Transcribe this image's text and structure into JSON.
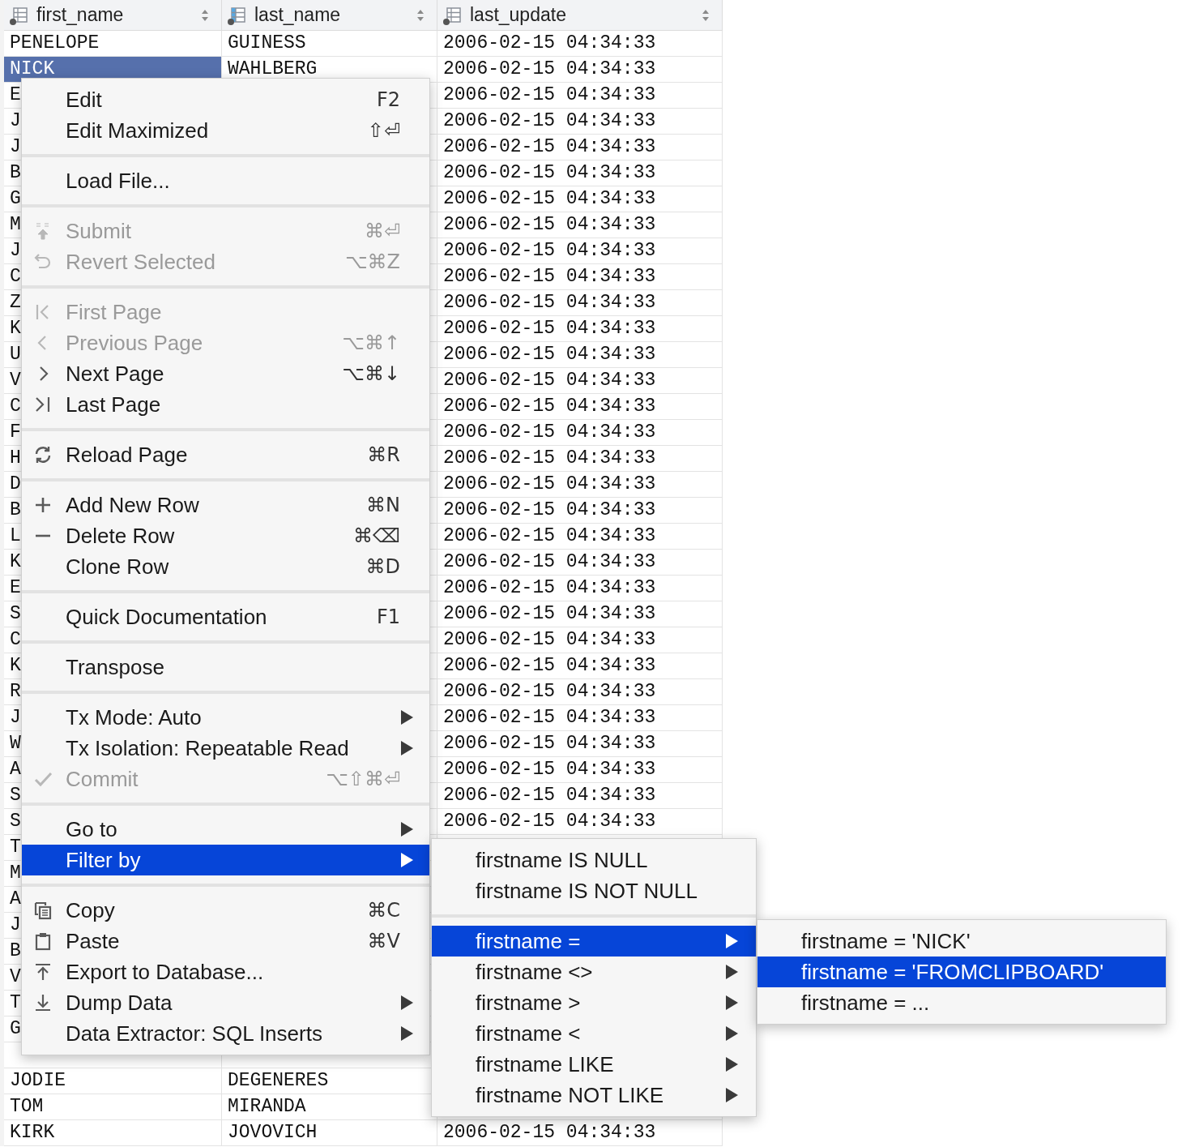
{
  "table": {
    "columns": [
      {
        "label": "first_name",
        "highlighted": false
      },
      {
        "label": "last_name",
        "highlighted": true
      },
      {
        "label": "last_update",
        "highlighted": false
      }
    ],
    "rows": [
      {
        "first_name": "PENELOPE",
        "last_name": "GUINESS",
        "last_update": "2006-02-15 04:34:33",
        "selected": false
      },
      {
        "first_name": "NICK",
        "last_name": "WAHLBERG",
        "last_update": "2006-02-15 04:34:33",
        "selected": true
      },
      {
        "first_name": "E",
        "last_update": "2006-02-15 04:34:33",
        "selected": false
      },
      {
        "first_name": "J",
        "last_update": "2006-02-15 04:34:33",
        "selected": false
      },
      {
        "first_name": "J",
        "last_update": "2006-02-15 04:34:33",
        "selected": false
      },
      {
        "first_name": "B",
        "last_update": "2006-02-15 04:34:33",
        "selected": false
      },
      {
        "first_name": "G",
        "last_update": "2006-02-15 04:34:33",
        "selected": false
      },
      {
        "first_name": "M",
        "last_update": "2006-02-15 04:34:33",
        "selected": false
      },
      {
        "first_name": "J",
        "last_update": "2006-02-15 04:34:33",
        "selected": false
      },
      {
        "first_name": "C",
        "last_update": "2006-02-15 04:34:33",
        "selected": false
      },
      {
        "first_name": "Z",
        "last_update": "2006-02-15 04:34:33",
        "selected": false
      },
      {
        "first_name": "K",
        "last_update": "2006-02-15 04:34:33",
        "selected": false
      },
      {
        "first_name": "U",
        "last_update": "2006-02-15 04:34:33",
        "selected": false
      },
      {
        "first_name": "V",
        "last_update": "2006-02-15 04:34:33",
        "selected": false
      },
      {
        "first_name": "C",
        "last_update": "2006-02-15 04:34:33",
        "selected": false
      },
      {
        "first_name": "F",
        "last_update": "2006-02-15 04:34:33",
        "selected": false
      },
      {
        "first_name": "H",
        "last_update": "2006-02-15 04:34:33",
        "selected": false
      },
      {
        "first_name": "D",
        "last_update": "2006-02-15 04:34:33",
        "selected": false
      },
      {
        "first_name": "B",
        "last_update": "2006-02-15 04:34:33",
        "selected": false
      },
      {
        "first_name": "L",
        "last_update": "2006-02-15 04:34:33",
        "selected": false
      },
      {
        "first_name": "K",
        "last_update": "2006-02-15 04:34:33",
        "selected": false
      },
      {
        "first_name": "E",
        "last_update": "2006-02-15 04:34:33",
        "selected": false
      },
      {
        "first_name": "S",
        "last_update": "2006-02-15 04:34:33",
        "selected": false
      },
      {
        "first_name": "C",
        "last_update": "2006-02-15 04:34:33",
        "selected": false
      },
      {
        "first_name": "K",
        "last_update": "2006-02-15 04:34:33",
        "selected": false
      },
      {
        "first_name": "R",
        "last_update": "2006-02-15 04:34:33",
        "selected": false
      },
      {
        "first_name": "J",
        "last_update": "2006-02-15 04:34:33",
        "selected": false
      },
      {
        "first_name": "W",
        "last_update": "2006-02-15 04:34:33",
        "selected": false
      },
      {
        "first_name": "A",
        "last_update": "2006-02-15 04:34:33",
        "selected": false
      },
      {
        "first_name": "S",
        "last_update": "2006-02-15 04:34:33",
        "selected": false
      },
      {
        "first_name": "S",
        "last_update": "2006-02-15 04:34:33",
        "selected": false
      },
      {
        "first_name": "T",
        "selected": false
      },
      {
        "first_name": "M",
        "selected": false
      },
      {
        "first_name": "A",
        "selected": false
      },
      {
        "first_name": "J",
        "selected": false
      },
      {
        "first_name": "B",
        "selected": false
      },
      {
        "first_name": "V",
        "selected": false
      },
      {
        "first_name": "T",
        "selected": false
      },
      {
        "first_name": "G",
        "selected": false
      },
      {
        "selected": false
      },
      {
        "first_name": "JODIE",
        "last_name": "DEGENERES",
        "selected": false
      },
      {
        "first_name": "TOM",
        "last_name": "MIRANDA",
        "selected": false
      },
      {
        "first_name": "KIRK",
        "last_name": "JOVOVICH",
        "last_update": "2006-02-15 04:34:33",
        "selected": false
      }
    ]
  },
  "context_menu": {
    "sections": [
      {
        "items": [
          {
            "label": "Edit",
            "shortcut": "F2",
            "disabled": false,
            "selected": false,
            "submenu": false
          },
          {
            "label": "Edit Maximized",
            "shortcut": "⇧⏎",
            "disabled": false,
            "selected": false,
            "submenu": false
          }
        ]
      },
      {
        "items": [
          {
            "label": "Load File...",
            "disabled": false,
            "selected": false,
            "submenu": false
          }
        ]
      },
      {
        "items": [
          {
            "label": "Submit",
            "shortcut": "⌘⏎",
            "disabled": true,
            "selected": false,
            "submenu": false
          },
          {
            "label": "Revert Selected",
            "shortcut": "⌥⌘Z",
            "disabled": true,
            "selected": false,
            "submenu": false
          }
        ]
      },
      {
        "items": [
          {
            "label": "First Page",
            "disabled": true,
            "selected": false,
            "submenu": false
          },
          {
            "label": "Previous Page",
            "shortcut": "⌥⌘↑",
            "disabled": true,
            "selected": false,
            "submenu": false
          },
          {
            "label": "Next Page",
            "shortcut": "⌥⌘↓",
            "disabled": false,
            "selected": false,
            "submenu": false
          },
          {
            "label": "Last Page",
            "disabled": false,
            "selected": false,
            "submenu": false
          }
        ]
      },
      {
        "items": [
          {
            "label": "Reload Page",
            "shortcut": "⌘R",
            "disabled": false,
            "selected": false,
            "submenu": false
          }
        ]
      },
      {
        "items": [
          {
            "label": "Add New Row",
            "shortcut": "⌘N",
            "disabled": false,
            "selected": false,
            "submenu": false
          },
          {
            "label": "Delete Row",
            "shortcut": "⌘⌫",
            "disabled": false,
            "selected": false,
            "submenu": false
          },
          {
            "label": "Clone Row",
            "shortcut": "⌘D",
            "disabled": false,
            "selected": false,
            "submenu": false
          }
        ]
      },
      {
        "items": [
          {
            "label": "Quick Documentation",
            "shortcut": "F1",
            "disabled": false,
            "selected": false,
            "submenu": false
          }
        ]
      },
      {
        "items": [
          {
            "label": "Transpose",
            "disabled": false,
            "selected": false,
            "submenu": false
          }
        ]
      },
      {
        "items": [
          {
            "label": "Tx Mode: Auto",
            "disabled": false,
            "selected": false,
            "submenu": true
          },
          {
            "label": "Tx Isolation: Repeatable Read",
            "disabled": false,
            "selected": false,
            "submenu": true
          },
          {
            "label": "Commit",
            "shortcut": "⌥⇧⌘⏎",
            "disabled": true,
            "selected": false,
            "submenu": false
          }
        ]
      },
      {
        "items": [
          {
            "label": "Go to",
            "disabled": false,
            "selected": false,
            "submenu": true
          },
          {
            "label": "Filter by",
            "disabled": false,
            "selected": true,
            "submenu": true
          }
        ]
      },
      {
        "items": [
          {
            "label": "Copy",
            "shortcut": "⌘C",
            "disabled": false,
            "selected": false,
            "submenu": false
          },
          {
            "label": "Paste",
            "shortcut": "⌘V",
            "disabled": false,
            "selected": false,
            "submenu": false
          },
          {
            "label": "Export to Database...",
            "disabled": false,
            "selected": false,
            "submenu": false
          },
          {
            "label": "Dump Data",
            "disabled": false,
            "selected": false,
            "submenu": true
          },
          {
            "label": "Data Extractor: SQL Inserts",
            "disabled": false,
            "selected": false,
            "submenu": true
          }
        ]
      }
    ]
  },
  "filter_menu": {
    "sections": [
      {
        "items": [
          {
            "label": "firstname IS NULL",
            "selected": false,
            "submenu": false
          },
          {
            "label": "firstname IS NOT NULL",
            "selected": false,
            "submenu": false
          }
        ]
      },
      {
        "items": [
          {
            "label": "firstname =",
            "selected": true,
            "submenu": true
          },
          {
            "label": "firstname <>",
            "selected": false,
            "submenu": true
          },
          {
            "label": "firstname >",
            "selected": false,
            "submenu": true
          },
          {
            "label": "firstname <",
            "selected": false,
            "submenu": true
          },
          {
            "label": "firstname LIKE",
            "selected": false,
            "submenu": true
          },
          {
            "label": "firstname NOT LIKE",
            "selected": false,
            "submenu": true
          }
        ]
      }
    ]
  },
  "equals_menu": {
    "items": [
      {
        "label": "firstname = 'NICK'",
        "selected": false
      },
      {
        "label": "firstname = 'FROMCLIPBOARD'",
        "selected": true
      },
      {
        "label": "firstname = ...",
        "selected": false
      }
    ]
  }
}
